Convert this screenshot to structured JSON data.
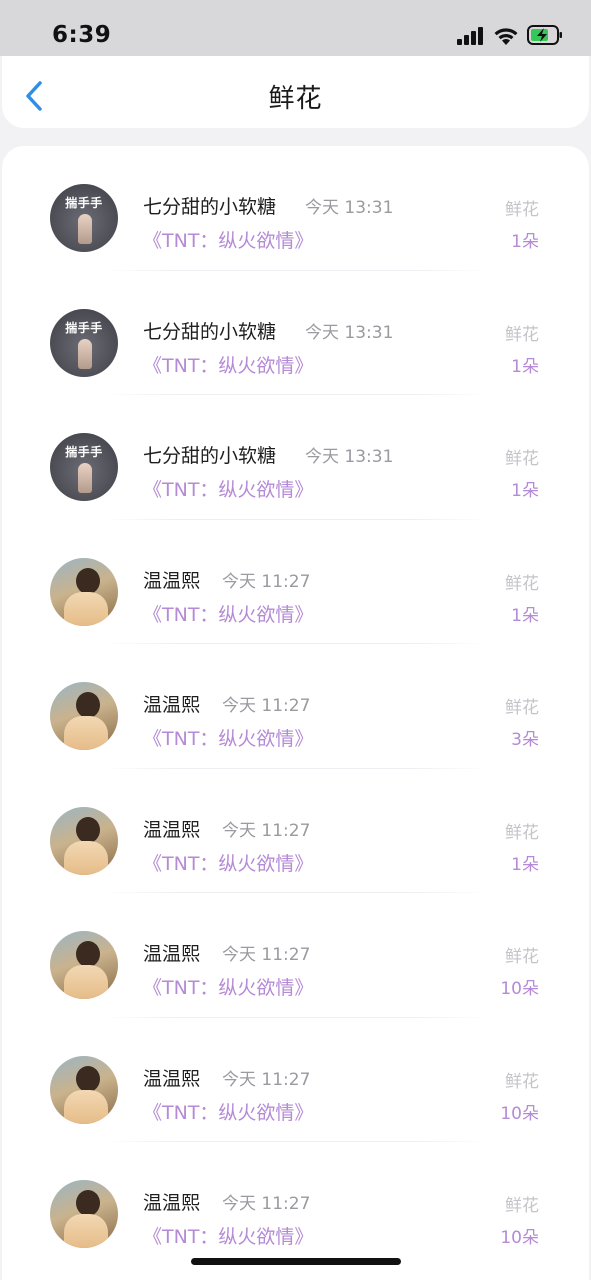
{
  "status_bar": {
    "time": "6:39",
    "icons": [
      "signal-icon",
      "wifi-icon",
      "battery-charging-icon"
    ],
    "battery_color": "#35c759"
  },
  "nav": {
    "title": "鲜花",
    "back_icon": "chevron-left-icon",
    "accent": "#2f8fe6"
  },
  "colors": {
    "purple": "#b58ad6",
    "muted": "#9a9aa0"
  },
  "records": [
    {
      "user": "七分甜的小软糖",
      "avatar_tag": "揣手手",
      "time": "今天 13:31",
      "book": "《TNT：纵火欲情》",
      "gift": "鲜花",
      "count": "1朵"
    },
    {
      "user": "七分甜的小软糖",
      "avatar_tag": "揣手手",
      "time": "今天 13:31",
      "book": "《TNT：纵火欲情》",
      "gift": "鲜花",
      "count": "1朵"
    },
    {
      "user": "七分甜的小软糖",
      "avatar_tag": "揣手手",
      "time": "今天 13:31",
      "book": "《TNT：纵火欲情》",
      "gift": "鲜花",
      "count": "1朵"
    },
    {
      "user": "温温熙",
      "avatar_tag": "",
      "time": "今天 11:27",
      "book": "《TNT：纵火欲情》",
      "gift": "鲜花",
      "count": "1朵"
    },
    {
      "user": "温温熙",
      "avatar_tag": "",
      "time": "今天 11:27",
      "book": "《TNT：纵火欲情》",
      "gift": "鲜花",
      "count": "3朵"
    },
    {
      "user": "温温熙",
      "avatar_tag": "",
      "time": "今天 11:27",
      "book": "《TNT：纵火欲情》",
      "gift": "鲜花",
      "count": "1朵"
    },
    {
      "user": "温温熙",
      "avatar_tag": "",
      "time": "今天 11:27",
      "book": "《TNT：纵火欲情》",
      "gift": "鲜花",
      "count": "10朵"
    },
    {
      "user": "温温熙",
      "avatar_tag": "",
      "time": "今天 11:27",
      "book": "《TNT：纵火欲情》",
      "gift": "鲜花",
      "count": "10朵"
    },
    {
      "user": "温温熙",
      "avatar_tag": "",
      "time": "今天 11:27",
      "book": "《TNT：纵火欲情》",
      "gift": "鲜花",
      "count": "10朵"
    }
  ]
}
